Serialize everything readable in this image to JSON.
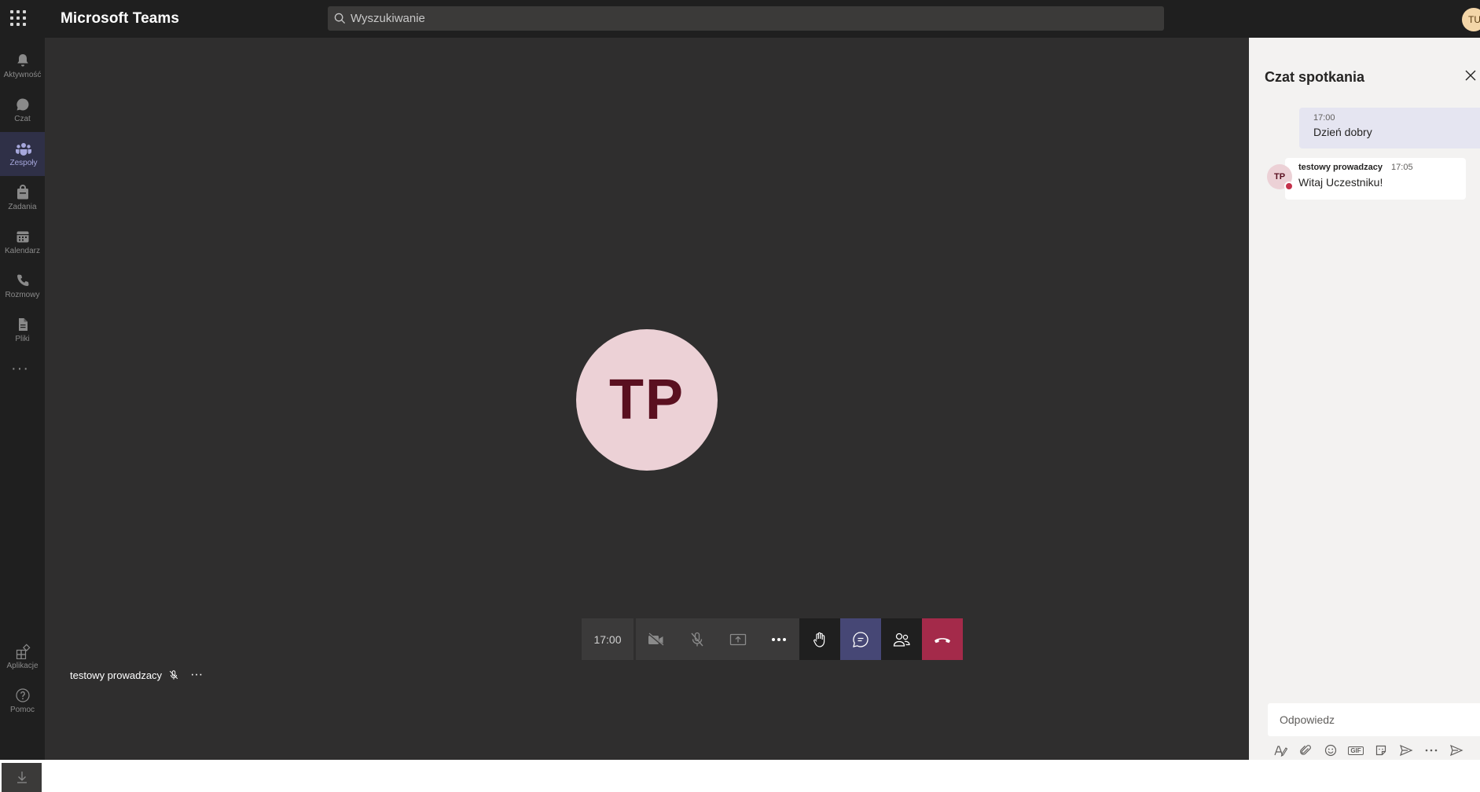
{
  "app": {
    "title": "Microsoft Teams"
  },
  "search": {
    "placeholder": "Wyszukiwanie"
  },
  "user": {
    "initials": "TU"
  },
  "rail": {
    "items": [
      {
        "label": "Aktywność",
        "icon": "bell-icon"
      },
      {
        "label": "Czat",
        "icon": "chat-icon"
      },
      {
        "label": "Zespoły",
        "icon": "teams-icon",
        "active": true
      },
      {
        "label": "Zadania",
        "icon": "assignments-icon"
      },
      {
        "label": "Kalendarz",
        "icon": "calendar-icon"
      },
      {
        "label": "Rozmowy",
        "icon": "phone-icon"
      },
      {
        "label": "Pliki",
        "icon": "file-icon"
      }
    ],
    "more": "···",
    "bottom": [
      {
        "label": "Aplikacje",
        "icon": "apps-icon"
      },
      {
        "label": "Pomoc",
        "icon": "help-icon"
      }
    ]
  },
  "meeting": {
    "speaker_initials": "TP",
    "participant_name": "testowy prowadzacy",
    "timer": "17:00"
  },
  "chat": {
    "title": "Czat spotkania",
    "messages": [
      {
        "own": true,
        "time": "17:00",
        "text": "Dzień dobry"
      },
      {
        "own": false,
        "initials": "TP",
        "author": "testowy prowadzacy",
        "time": "17:05",
        "text": "Witaj Uczestniku!"
      }
    ],
    "reply_placeholder": "Odpowiedz",
    "toolbar_gif_label": "GIF"
  },
  "colors": {
    "rail_bg": "#1f1f1f",
    "stage_bg": "#2f2e2e",
    "avatar_bg": "#ecd1d6",
    "accent": "#464775",
    "hangup": "#a42a4a",
    "presence_busy": "#c4314b"
  }
}
